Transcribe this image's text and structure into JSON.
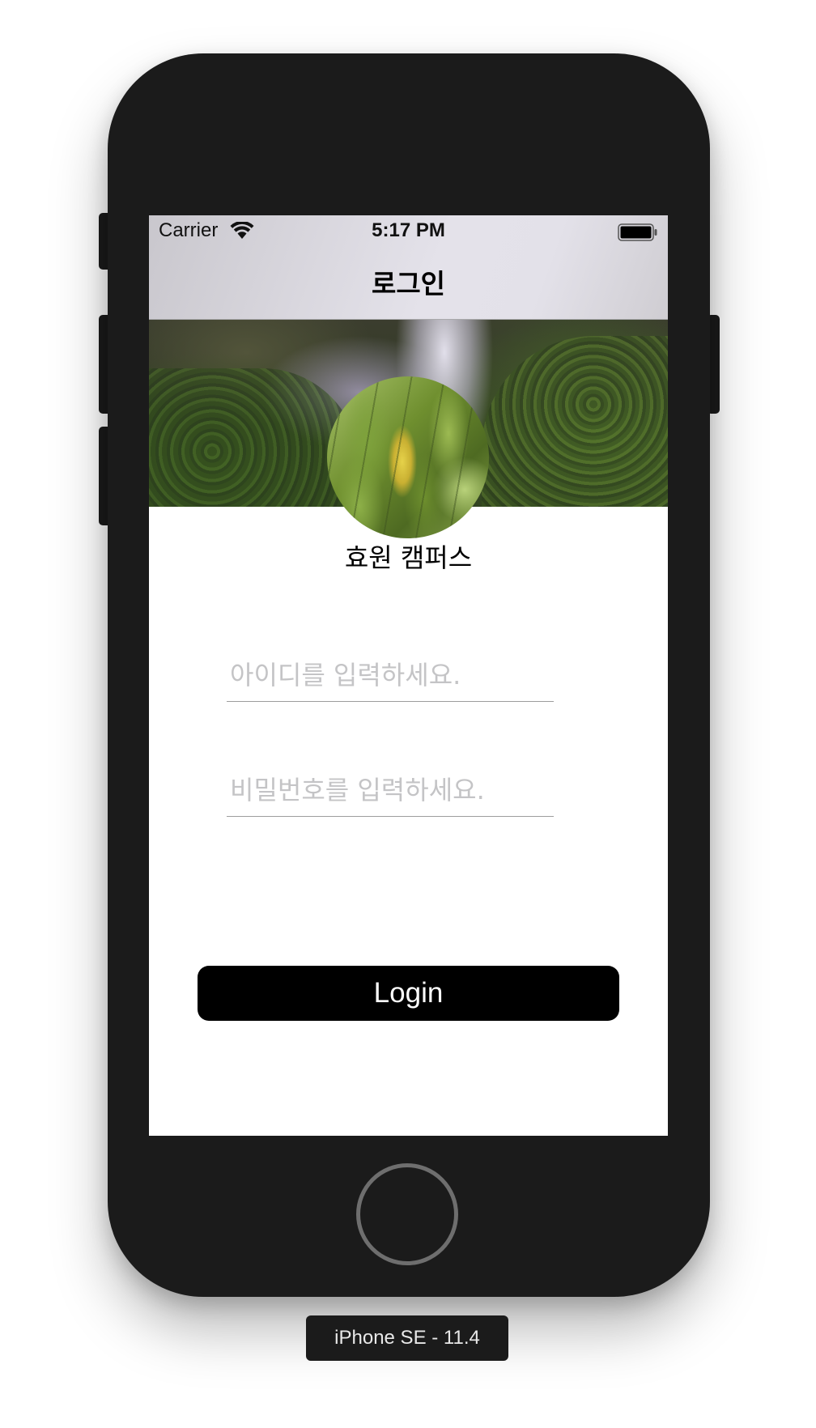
{
  "status_bar": {
    "carrier": "Carrier",
    "time": "5:17 PM",
    "wifi_icon": "wifi-icon",
    "battery_icon": "battery-icon"
  },
  "nav": {
    "title": "로그인"
  },
  "profile": {
    "name": "효원 캠퍼스",
    "header_image": "waterfall-photo",
    "avatar_image": "leaf-photo"
  },
  "form": {
    "id_placeholder": "아이디를 입력하세요.",
    "id_value": "",
    "password_placeholder": "비밀번호를 입력하세요.",
    "password_value": "",
    "login_label": "Login"
  },
  "device": {
    "label": "iPhone SE - 11.4"
  },
  "colors": {
    "button_bg": "#000000",
    "button_text": "#ffffff",
    "placeholder": "#c4c4c6",
    "phone_body": "#1b1b1b",
    "home_ring": "#6e6e6e"
  }
}
